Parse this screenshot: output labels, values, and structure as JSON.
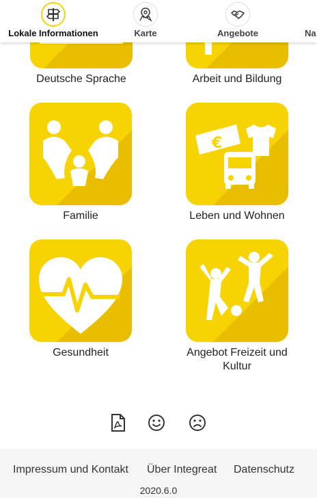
{
  "nav": {
    "items": [
      {
        "label": "Lokale Informationen",
        "icon": "signpost-icon",
        "active": true
      },
      {
        "label": "Karte",
        "icon": "map-pin-icon",
        "active": false
      },
      {
        "label": "Angebote",
        "icon": "handshake-icon",
        "active": false
      },
      {
        "label": "Na",
        "icon": "news-icon",
        "active": false
      }
    ]
  },
  "tiles": [
    {
      "label": "Deutsche Sprache",
      "icon": "language-icon"
    },
    {
      "label": "Arbeit und Bildung",
      "icon": "work-education-icon"
    },
    {
      "label": "Familie",
      "icon": "family-icon"
    },
    {
      "label": "Leben und Wohnen",
      "icon": "living-icon"
    },
    {
      "label": "Gesundheit",
      "icon": "heart-pulse-icon"
    },
    {
      "label": "Angebot Freizeit und Kultur",
      "icon": "leisure-icon"
    }
  ],
  "feedback": {
    "pdf": "pdf-icon",
    "positive": "smile-icon",
    "negative": "frown-icon"
  },
  "footer": {
    "links": [
      "Impressum und Kontakt",
      "Über Integreat",
      "Datenschutz"
    ],
    "version": "2020.6.0"
  },
  "colors": {
    "accent": "#f7d304",
    "accent_shadow": "#e8b800"
  }
}
